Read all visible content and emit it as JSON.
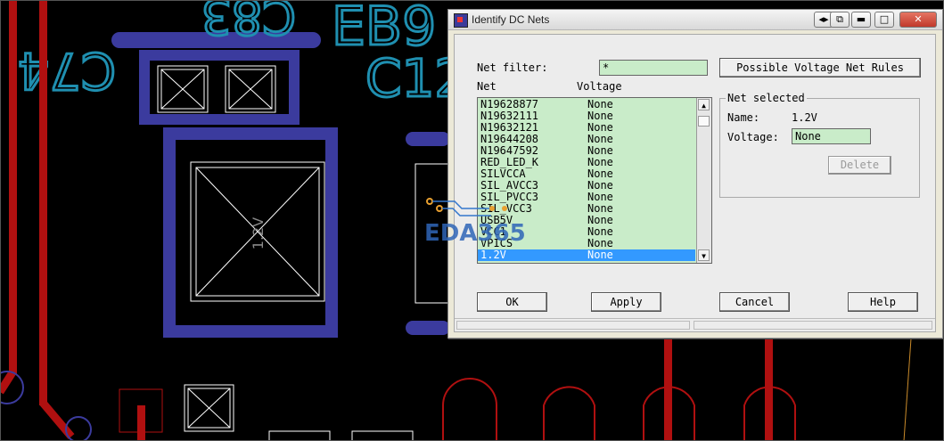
{
  "dialog": {
    "title": "Identify DC Nets",
    "titlebar_buttons": [
      "pin-icon",
      "restore-icon",
      "minimize-icon",
      "maximize-icon",
      "close-icon"
    ],
    "net_filter_label": "Net filter:",
    "net_filter_value": "*",
    "possible_rules_button": "Possible Voltage Net Rules",
    "list_headers": {
      "net": "Net",
      "voltage": "Voltage"
    },
    "nets": [
      {
        "net": "N19628877",
        "voltage": "None"
      },
      {
        "net": "N19632111",
        "voltage": "None"
      },
      {
        "net": "N19632121",
        "voltage": "None"
      },
      {
        "net": "N19644208",
        "voltage": "None"
      },
      {
        "net": "N19647592",
        "voltage": "None"
      },
      {
        "net": "RED_LED_K",
        "voltage": "None"
      },
      {
        "net": "SILVCCA",
        "voltage": "None"
      },
      {
        "net": "SIL_AVCC3",
        "voltage": "None"
      },
      {
        "net": "SIL_PVCC3",
        "voltage": "None"
      },
      {
        "net": "SIL_VCC3",
        "voltage": "None"
      },
      {
        "net": "USB5V",
        "voltage": "None"
      },
      {
        "net": "VCC1",
        "voltage": "None"
      },
      {
        "net": "VPICS",
        "voltage": "None"
      },
      {
        "net": "1.2V",
        "voltage": "None"
      }
    ],
    "selected_index": 13,
    "net_selected": {
      "title": "Net selected",
      "name_label": "Name:",
      "name_value": "1.2V",
      "voltage_label": "Voltage:",
      "voltage_value": "None",
      "delete_button": "Delete"
    },
    "buttons": {
      "ok": "OK",
      "apply": "Apply",
      "cancel": "Cancel",
      "help": "Help"
    }
  },
  "background": {
    "silkscreen_labels": [
      "C83",
      "EB9",
      "C74",
      "C12",
      "1.2V"
    ],
    "watermark": "EDA365"
  },
  "colors": {
    "pad_outline": "#3b3b9e",
    "trace": "#b01010",
    "silkscreen": "#1f8fb0",
    "list_bg": "#c9ecc9",
    "selection": "#3399ff"
  }
}
